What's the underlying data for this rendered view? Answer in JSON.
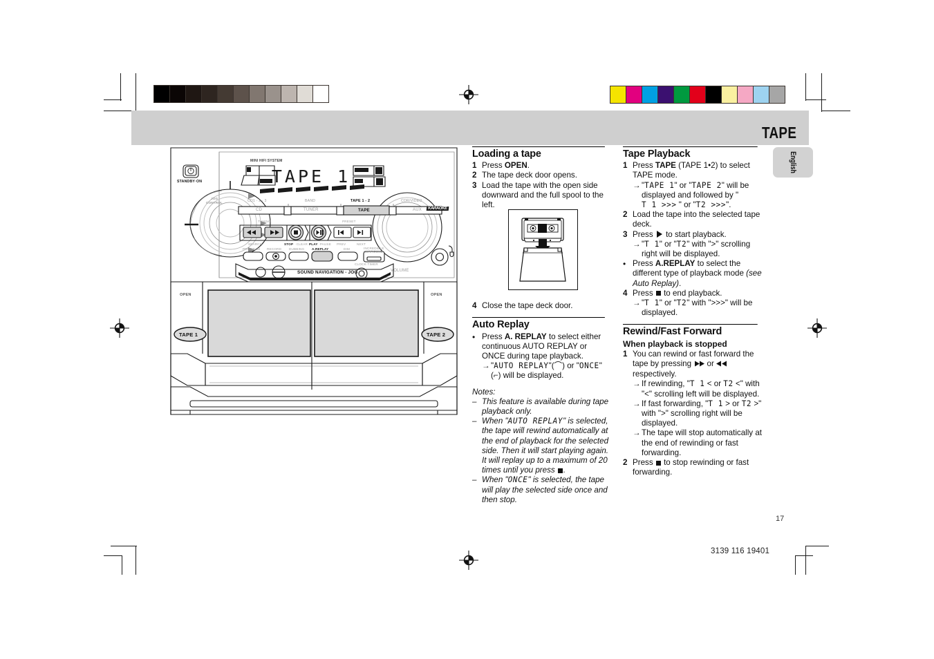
{
  "header": {
    "title": "TAPE"
  },
  "lang_tab": {
    "label": "English"
  },
  "footer": {
    "page_number": "17",
    "doc_number": "3139 116 19401"
  },
  "loading": {
    "heading": "Loading a tape",
    "steps": [
      {
        "num": "1",
        "text_a": "Press ",
        "bold": "OPEN",
        "text_b": "."
      },
      {
        "num": "2",
        "text_a": "The tape deck door opens.",
        "bold": "",
        "text_b": ""
      },
      {
        "num": "3",
        "text_a": "Load the tape with the open side downward and the full spool to the left.",
        "bold": "",
        "text_b": ""
      }
    ],
    "step4_num": "4",
    "step4_text": "Close the tape deck door."
  },
  "auto_replay": {
    "heading": "Auto Replay",
    "bullet_a": "Press ",
    "bullet_bold": "A. REPLAY",
    "bullet_b": " to select either continuous AUTO REPLAY or ONCE during tape playback.",
    "arrow_pre": "\"",
    "arrow_lcd1": "AUTO REPLAY",
    "arrow_mid": "\"(⌒) or \"",
    "arrow_lcd2": "ONCE",
    "arrow_post": "\"(⌐)  will be displayed.",
    "notes_heading": "Notes:",
    "notes": [
      {
        "pre": "This feature is available during tape playback only.",
        "lcd": "",
        "post": ""
      },
      {
        "pre": "When \"",
        "lcd": "AUTO REPLAY",
        "post": "\" is selected, the tape will rewind automatically at the end of playback for the selected side. Then it will start playing again. It will replay up to a maximum of 20 times until you press "
      },
      {
        "pre": "When \"",
        "lcd": "ONCE",
        "post": "\" is selected, the tape will play the selected side once and then stop."
      }
    ]
  },
  "tape_playback": {
    "heading": "Tape Playback",
    "s1_num": "1",
    "s1_a": "Press ",
    "s1_bold": "TAPE",
    "s1_b": "  (TAPE 1•2) to select TAPE mode.",
    "s1_arrow_a": "\"",
    "s1_arrow_lcd1": "TAPE  1",
    "s1_arrow_b": "\" or \"",
    "s1_arrow_lcd2": "TAPE  2",
    "s1_arrow_c": "\" will be displayed and followed by \"",
    "s1_arrow_lcd3": "T 1  >>>",
    "s1_arrow_d": " \" or \"",
    "s1_arrow_lcd4": "T2  >>>",
    "s1_arrow_e": "\".",
    "s2_num": "2",
    "s2_text": "Load the tape into the selected tape deck.",
    "s3_num": "3",
    "s3_a": "Press ",
    "s3_b": " to start playback.",
    "s3_arrow_a": "\"",
    "s3_arrow_lcd1": "T 1",
    "s3_arrow_b": "\"  or \"",
    "s3_arrow_lcd2": "T2",
    "s3_arrow_c": "\" with \">\" scrolling right will be displayed.",
    "bullet_a": "Press ",
    "bullet_bold": "A.REPLAY",
    "bullet_b": " to select the different type of playback mode ",
    "bullet_it": "(see Auto Replay)",
    "bullet_c": ".",
    "s4_num": "4",
    "s4_a": "Press ",
    "s4_b": " to end playback.",
    "s4_arrow_a": "\"",
    "s4_arrow_lcd1": "T 1",
    "s4_arrow_b": "\"  or \"",
    "s4_arrow_lcd2": "T2",
    "s4_arrow_c": "\" with \">>>\" will be displayed."
  },
  "rewind_ff": {
    "heading": "Rewind/Fast Forward",
    "subheading": "When playback is stopped",
    "s1_num": "1",
    "s1_a": "You can rewind or fast forward the tape by pressing ",
    "s1_b": " or ",
    "s1_c": " respectively.",
    "a1_a": "If rewinding, \"",
    "a1_lcd1": "T 1",
    "a1_b": "  <  or ",
    "a1_lcd2": "T2",
    "a1_c": "  <\" with \"<\" scrolling left will be displayed.",
    "a2_a": "If fast forwarding, \"",
    "a2_lcd1": "T 1",
    "a2_b": "  >  or ",
    "a2_lcd2": "T2",
    "a2_c": "  >\" with \">\" scrolling right will be displayed.",
    "a3": "The tape will stop automatically at the end of rewinding or fast forwarding.",
    "s2_num": "2",
    "s2_a": "Press ",
    "s2_b": " to stop rewinding or fast forwarding."
  },
  "hifi": {
    "mini_label": "MINI HIFI SYSTEM",
    "standby_label": "STANDBY·ON",
    "display_text": "TAPE 1",
    "jog_label_1": "JOG",
    "jog_label_2": "CONTROL",
    "source_top": [
      "CD1 - 2 - 3",
      "BAND",
      "TAPE 1 - 2",
      "CDR/VIDEO"
    ],
    "source_buttons": [
      "CD",
      "TUNER",
      "TAPE",
      "AUX"
    ],
    "brand": "KARAOKE",
    "tuning_label": "TUNING",
    "preset_label": "PRESET",
    "transport_under": [
      "SEARCH",
      "STOP",
      "·CLEAR",
      "PLAY",
      "·PAUSE",
      "PREV",
      "NEXT"
    ],
    "feature_row": [
      "PROGRAM",
      "RECORD",
      "DUBBING",
      "A.REPLAY",
      "DIM",
      "INCREDIBLE SURROUND"
    ],
    "jog_bottom": "SOUND NAVIGATION - JOG",
    "clock_timer": "CLOCK·TIMER",
    "volume": "VOLUME",
    "open_left": "OPEN",
    "open_right": "OPEN",
    "tape1": "TAPE 1",
    "tape2": "TAPE 2",
    "jog_ring": [
      "REC",
      "OFF",
      "DISC",
      "TRACK",
      "ALBUM",
      "SOUND"
    ]
  },
  "calibration": {
    "grey_ramp": [
      "#000000",
      "#0b0605",
      "#1f1713",
      "#2e2520",
      "#443a33",
      "#5d524b",
      "#817770",
      "#9a928c",
      "#bdb5af",
      "#e0dcd6",
      "#ffffff"
    ],
    "color_bar": [
      "#f5e400",
      "#e2007f",
      "#00a0e3",
      "#3b1070",
      "#00993f",
      "#e2001a",
      "#000000",
      "#faf0a0",
      "#f5a8c4",
      "#9ed3f0",
      "#a6a6a6"
    ]
  }
}
